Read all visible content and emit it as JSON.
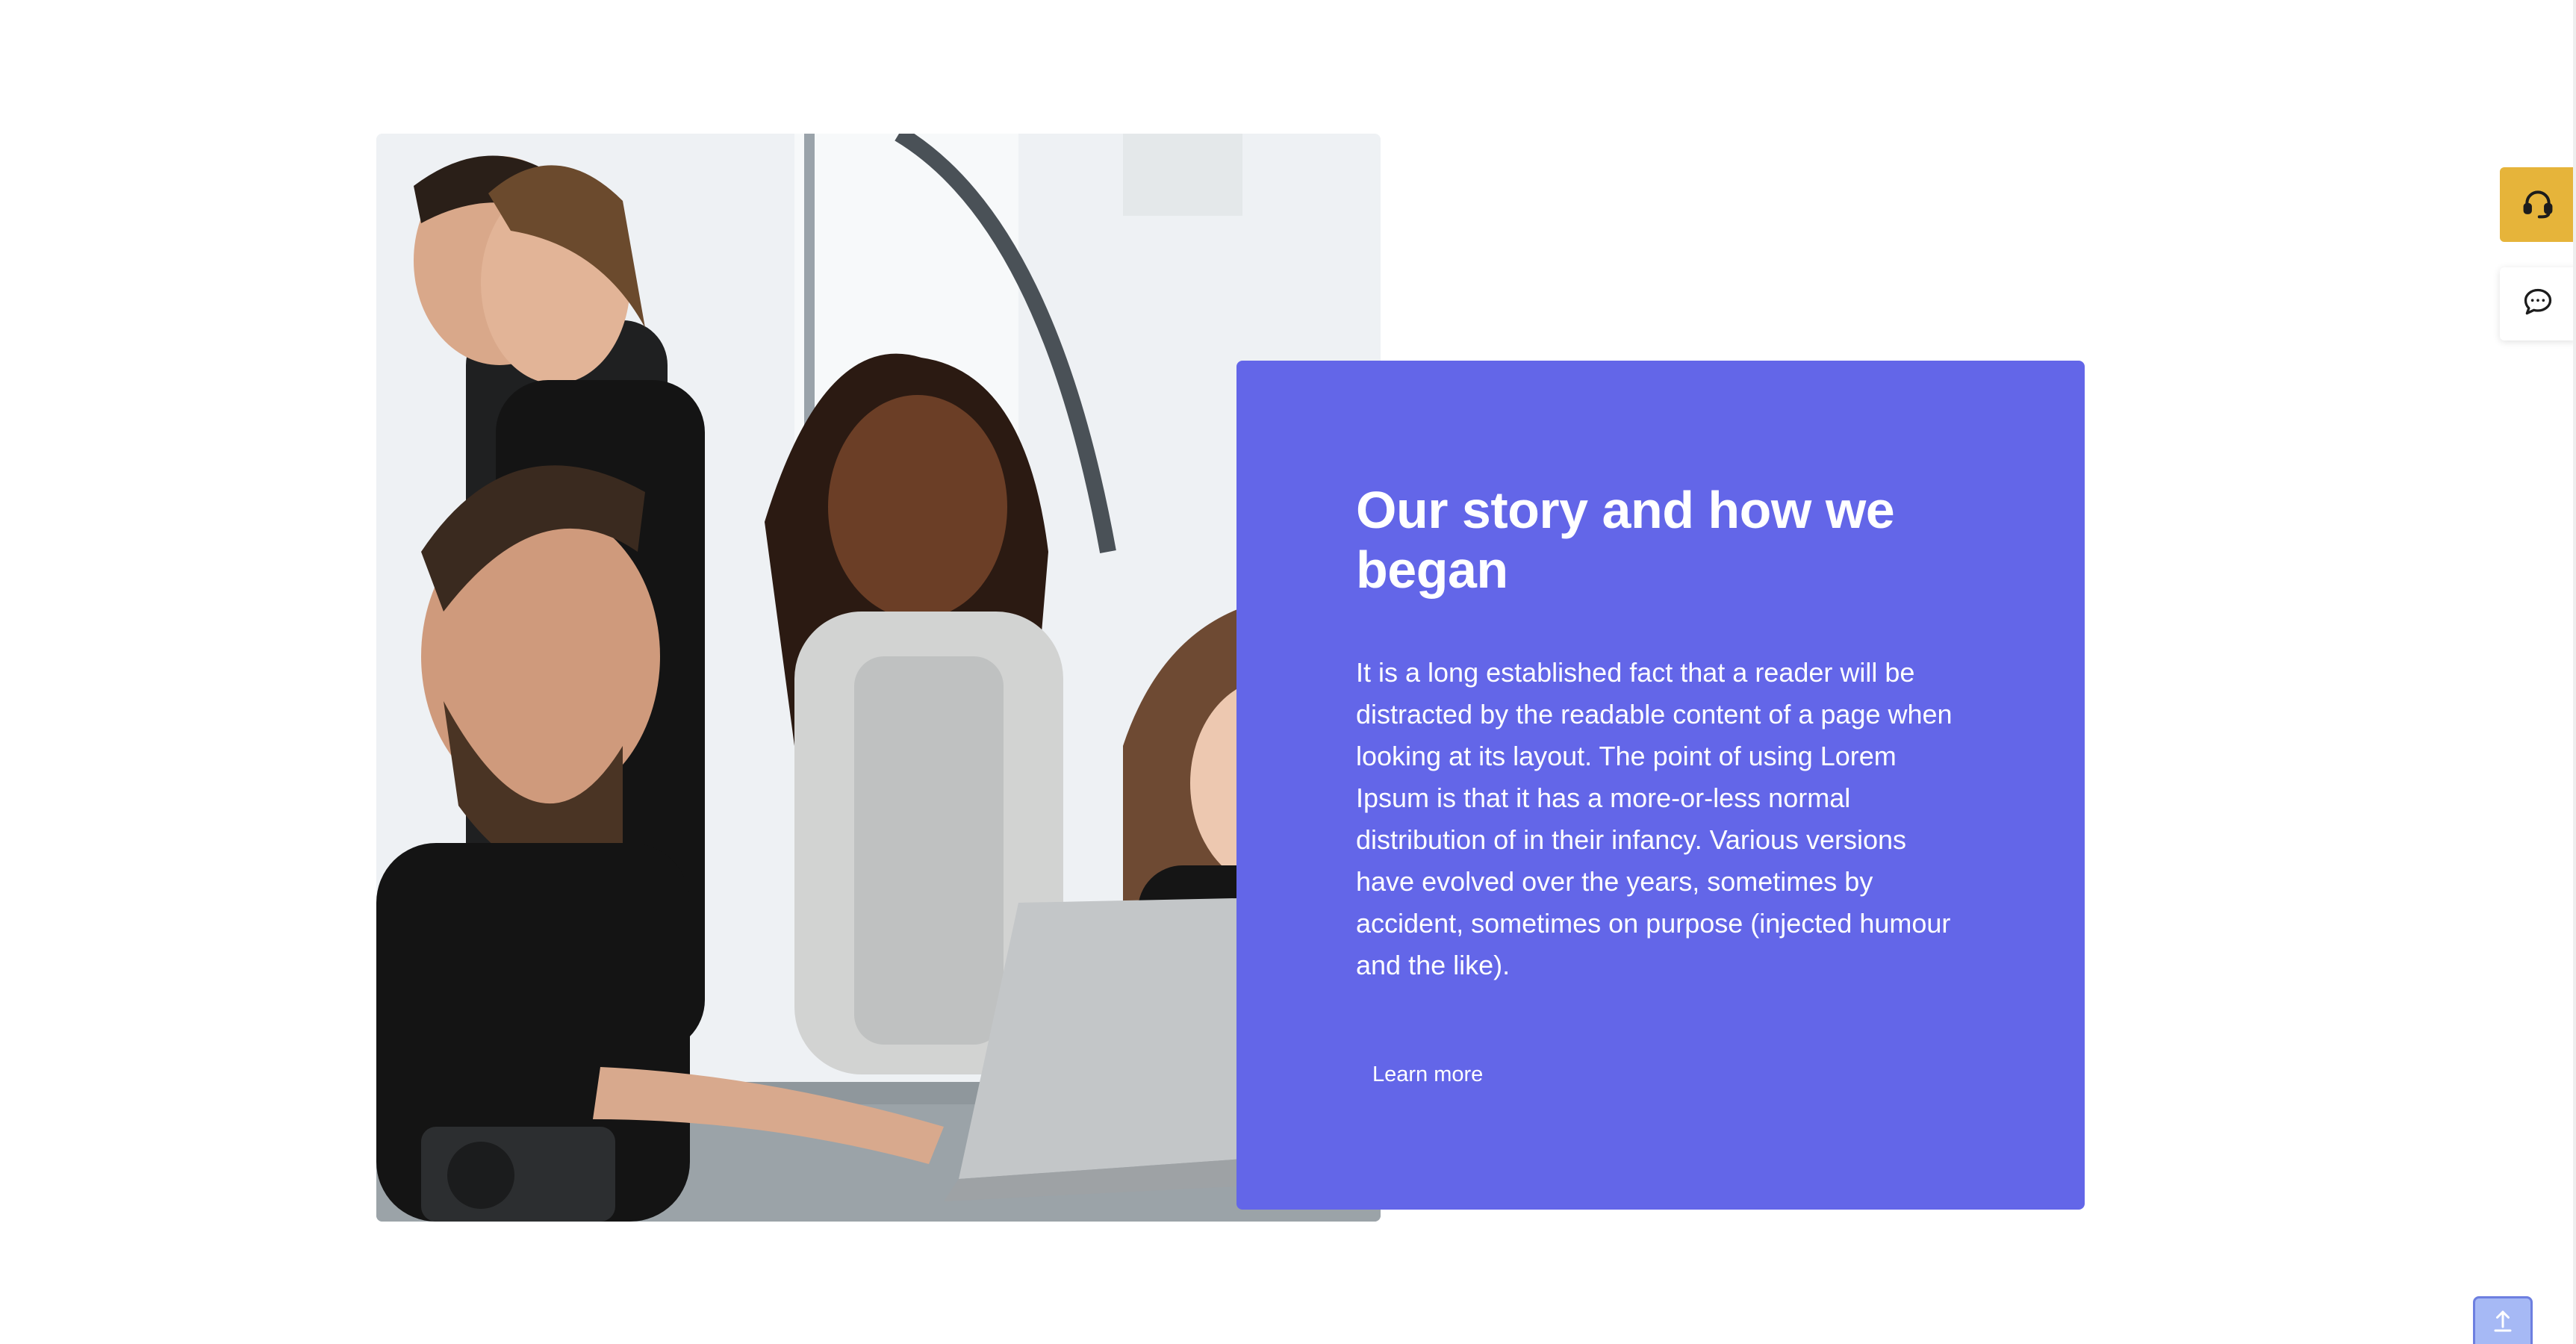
{
  "story": {
    "title": "Our story and how we began",
    "body": "It is a long established fact that a reader will be distracted by the readable content of a page when looking at its layout. The point of using Lorem Ipsum is that it has a more-or-less normal distribution of in their infancy. Various versions have evolved over the years, sometimes by accident, sometimes on purpose (injected humour and the like).",
    "cta_label": "Learn more",
    "card_color": "#6366e8"
  },
  "photo": {
    "icon": "team-photo"
  },
  "widgets": {
    "support_icon": "headset-icon",
    "support_color": "#e6b43a",
    "chat_icon": "chat-bubble-icon",
    "scroll_top_icon": "arrow-up-icon"
  }
}
